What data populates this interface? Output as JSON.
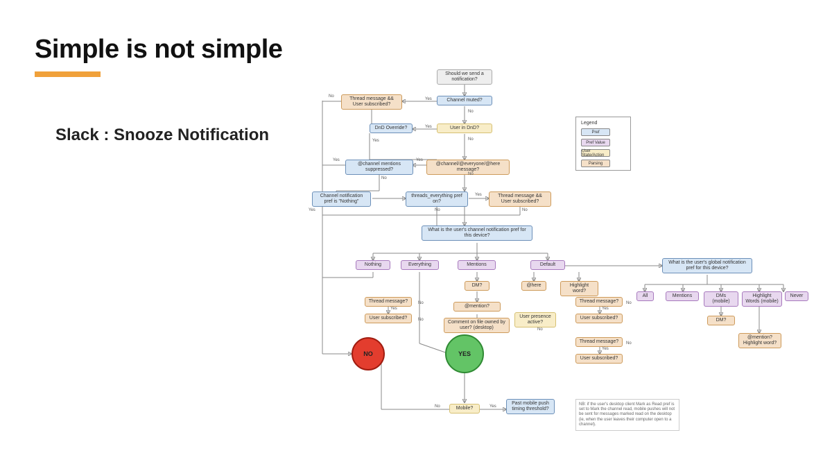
{
  "title": "Simple is not simple",
  "subtitle": "Slack : Snooze Notification",
  "legend": {
    "title": "Legend",
    "pref": "Pref",
    "pref_value": "Pref Value",
    "user_state": "User State/Action",
    "parsing": "Parsing"
  },
  "start": "Should we send a notification?",
  "channel_muted": "Channel muted?",
  "thread_sub_top": "Thread message && User subscribed?",
  "user_dnd": "User in DnD?",
  "dnd_override": "DnD Override?",
  "at_channel_msg": "@channel/@everyone/@here message?",
  "mentions_suppressed": "@channel mentions suppressed?",
  "channel_pref_nothing": "Channel notification pref is \"Nothing\"",
  "threads_pref": "threads_everything pref on?",
  "thread_sub_mid": "Thread message && User subscribed?",
  "channel_pref_q": "What is the user's channel notification pref for this device?",
  "opt_nothing": "Nothing",
  "opt_everything": "Everything",
  "opt_mentions": "Mentions",
  "opt_default": "Default",
  "global_pref_q": "What is the user's global notification pref for this device?",
  "opt_all": "All",
  "g_mentions": "Mentions",
  "g_dms": "DMs (mobile)",
  "g_highlight": "Highlight Words (mobile)",
  "g_never": "Never",
  "dm_q": "DM?",
  "at_here": "@here",
  "highlight_word": "Highlight word?",
  "thread_msg_l": "Thread message?",
  "user_sub_l": "User subscribed?",
  "at_mention": "@mention?",
  "comment_file": "Comment on file owned by user? (desktop)",
  "presence_active": "User presence active?",
  "thread_msg_m1": "Thread message?",
  "user_sub_m1": "User subscribed?",
  "thread_msg_m2": "Thread message?",
  "user_sub_m2": "User subscribed?",
  "dm_q2": "DM?",
  "mention_highlight": "@mention? Highlight word?",
  "mobile_q": "Mobile?",
  "push_timing": "Past mobile push timing threshold?",
  "no_circle": "NO",
  "yes_circle": "YES",
  "nb": "NB: if the user's desktop client Mark as Read pref is set to Mark the channel read, mobile pushes will not be sent for messages marked read on the desktop (ie, when the user leaves their computer open to a channel).",
  "y": "Yes",
  "n": "No"
}
